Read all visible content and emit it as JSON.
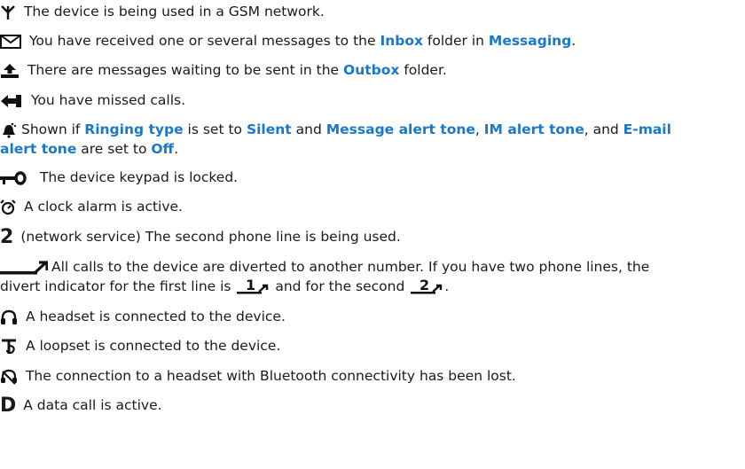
{
  "items": [
    {
      "icon": "antenna-icon",
      "text": "The device is being used in a GSM network."
    },
    {
      "icon": "envelope-icon",
      "parts": [
        "You have received one or several messages to the ",
        "Inbox",
        " folder in ",
        "Messaging",
        "."
      ]
    },
    {
      "icon": "outbox-upload-icon",
      "parts": [
        "There are messages waiting to be sent in the ",
        "Outbox",
        " folder."
      ]
    },
    {
      "icon": "missed-call-icon",
      "text": "You have missed calls."
    },
    {
      "icon": "silent-bell-icon",
      "parts": [
        "Shown if ",
        "Ringing type",
        " is set to ",
        "Silent",
        " and ",
        "Message alert tone",
        ", ",
        "IM alert tone",
        ", and ",
        "E-mail",
        "alert tone",
        " are set to ",
        "Off",
        "."
      ]
    },
    {
      "icon": "key-lock-icon",
      "text": "The device keypad is locked."
    },
    {
      "icon": "alarm-clock-icon",
      "text": "A clock alarm is active."
    },
    {
      "icon": "line-two-icon",
      "glyph": "2",
      "text": "(network service) The second phone line is being used."
    },
    {
      "icon": "call-divert-icon",
      "parts": [
        "All calls to the device are diverted to another number. If you have two phone lines, the",
        "divert indicator for the first line is ",
        "1",
        " and for the second ",
        "2",
        "."
      ]
    },
    {
      "icon": "headset-icon",
      "text": "A headset is connected to the device."
    },
    {
      "icon": "loopset-icon",
      "text": "A loopset is connected to the device."
    },
    {
      "icon": "bluetooth-lost-icon",
      "text": "The connection to a headset with Bluetooth connectivity has been lost."
    },
    {
      "icon": "data-call-icon",
      "glyph": "D",
      "text": "A data call is active."
    }
  ],
  "colors": {
    "keyword": "#1a78c8",
    "text": "#1a1a1a"
  }
}
